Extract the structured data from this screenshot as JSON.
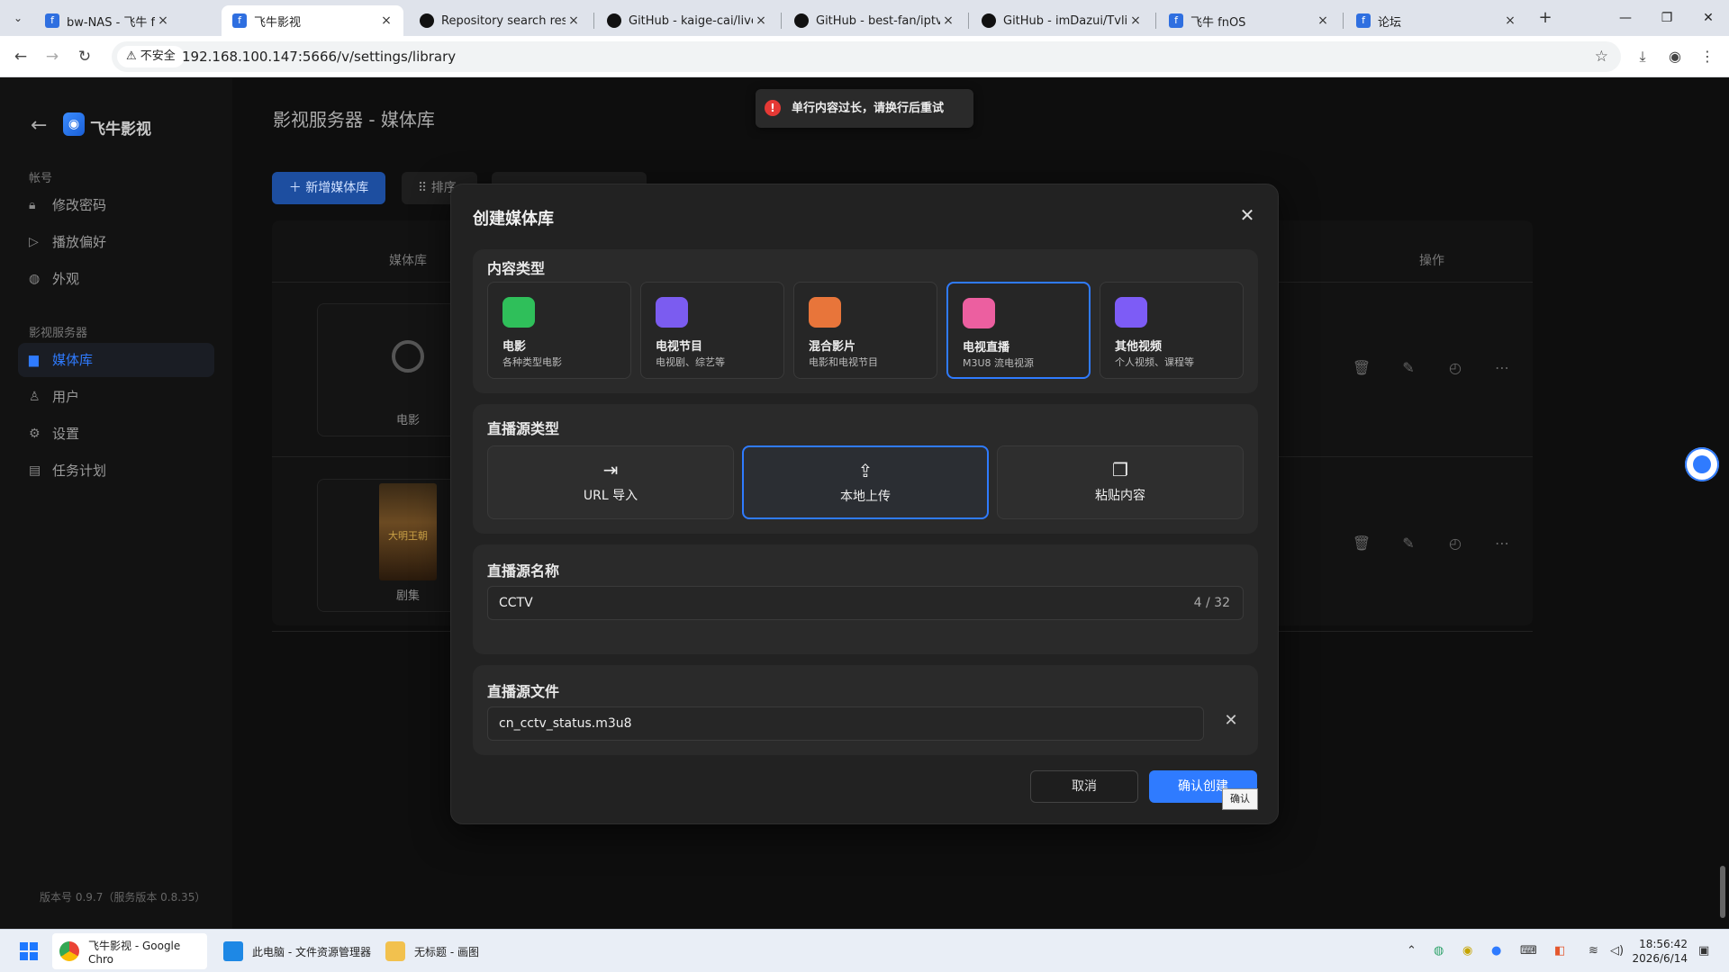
{
  "browser": {
    "tabs": [
      {
        "title": "bw-NAS - 飞牛 fnOS",
        "icon": "fnos-icon",
        "active": false
      },
      {
        "title": "飞牛影视",
        "icon": "fnos-icon",
        "active": true
      },
      {
        "title": "Repository search result",
        "icon": "github-icon",
        "active": false
      },
      {
        "title": "GitHub - kaige-cai/live",
        "icon": "github-icon",
        "active": false
      },
      {
        "title": "GitHub - best-fan/iptv-",
        "icon": "github-icon",
        "active": false
      },
      {
        "title": "GitHub - imDazui/Tvlist",
        "icon": "github-icon",
        "active": false
      },
      {
        "title": "飞牛 fnOS",
        "icon": "fnos-icon",
        "active": false
      },
      {
        "title": "论坛",
        "icon": "fnos-icon",
        "active": false
      }
    ],
    "insecure_label": "不安全",
    "url": "192.168.100.147:5666/v/settings/library"
  },
  "sidebar": {
    "app_name": "飞牛影视",
    "section_account": "帐号",
    "account_items": [
      {
        "label": "修改密码",
        "icon": "lock-icon"
      },
      {
        "label": "播放偏好",
        "icon": "play-circle-icon"
      },
      {
        "label": "外观",
        "icon": "palette-icon"
      }
    ],
    "section_server": "影视服务器",
    "server_items": [
      {
        "label": "媒体库",
        "icon": "folder-icon",
        "active": true
      },
      {
        "label": "用户",
        "icon": "user-icon"
      },
      {
        "label": "设置",
        "icon": "gear-icon"
      },
      {
        "label": "任务计划",
        "icon": "clipboard-icon"
      }
    ],
    "version": "版本号 0.9.7（服务版本 0.8.35）"
  },
  "main": {
    "title": "影视服务器 - 媒体库",
    "add_button": "新增媒体库",
    "sort_button": "排序",
    "col_library": "媒体库",
    "col_actions": "操作",
    "libraries": [
      {
        "label": "电影"
      },
      {
        "label": "剧集",
        "poster_text": "大明王朝"
      }
    ]
  },
  "toast": {
    "message": "单行内容过长，请换行后重试"
  },
  "modal": {
    "title": "创建媒体库",
    "content_type_label": "内容类型",
    "content_types": [
      {
        "name": "电影",
        "desc": "各种类型电影",
        "color": "#2fbf5a",
        "selected": false
      },
      {
        "name": "电视节目",
        "desc": "电视剧、综艺等",
        "color": "#7b5cf0",
        "selected": false
      },
      {
        "name": "混合影片",
        "desc": "电影和电视节目",
        "color": "#e8753a",
        "selected": false
      },
      {
        "name": "电视直播",
        "desc": "M3U8 流电视源",
        "color": "#ec5fa0",
        "selected": true
      },
      {
        "name": "其他视频",
        "desc": "个人视频、课程等",
        "color": "#7d5cf6",
        "selected": false
      }
    ],
    "source_type_label": "直播源类型",
    "source_types": [
      {
        "label": "URL 导入",
        "icon": "import-icon",
        "selected": false
      },
      {
        "label": "本地上传",
        "icon": "upload-icon",
        "selected": true
      },
      {
        "label": "粘贴内容",
        "icon": "copy-icon",
        "selected": false
      }
    ],
    "name_label": "直播源名称",
    "name_value": "CCTV",
    "name_counter": "4 / 32",
    "file_label": "直播源文件",
    "file_value": "cn_cctv_status.m3u8",
    "cancel": "取消",
    "confirm": "确认创建",
    "tooltip": "确认"
  },
  "taskbar": {
    "apps": [
      {
        "label": "飞牛影视 - Google Chro",
        "active": true
      },
      {
        "label": "此电脑 - 文件资源管理器",
        "active": false
      },
      {
        "label": "无标题 - 画图",
        "active": false
      }
    ],
    "time": "18:56:42",
    "date": "2026/6/14"
  },
  "colors": {
    "accent": "#2f7bff",
    "error": "#e53935"
  }
}
